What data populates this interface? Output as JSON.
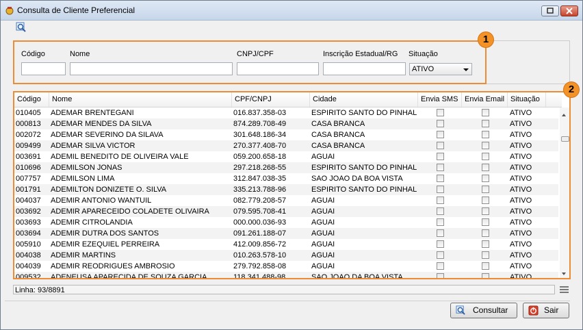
{
  "window": {
    "title": "Consulta de Cliente Preferencial"
  },
  "markers": {
    "one": "1",
    "two": "2"
  },
  "filters": {
    "codigo_label": "Código",
    "nome_label": "Nome",
    "cpf_label": "CNPJ/CPF",
    "ie_label": "Inscrição Estadual/RG",
    "situacao_label": "Situação",
    "situacao_value": "ATIVO",
    "codigo_value": "",
    "nome_value": "",
    "cpf_value": "",
    "ie_value": ""
  },
  "grid": {
    "columns": [
      "Código",
      "Nome",
      "CPF/CNPJ",
      "Cidade",
      "Envia SMS",
      "Envia Email",
      "Situação"
    ],
    "rows": [
      [
        "010405",
        "ADEMAR BRENTEGANI",
        "016.837.358-03",
        "ESPIRITO SANTO DO PINHAL",
        "ATIVO"
      ],
      [
        "000813",
        "ADEMAR MENDES DA SILVA",
        "874.289.708-49",
        "CASA BRANCA",
        "ATIVO"
      ],
      [
        "002072",
        "ADEMAR SEVERINO DA SILAVA",
        "301.648.186-34",
        "CASA BRANCA",
        "ATIVO"
      ],
      [
        "009499",
        "ADEMAR SILVA VICTOR",
        "270.377.408-70",
        "CASA BRANCA",
        "ATIVO"
      ],
      [
        "003691",
        "ADEMIL BENEDITO DE OLIVEIRA VALE",
        "059.200.658-18",
        "AGUAI",
        "ATIVO"
      ],
      [
        "010696",
        "ADEMILSON JONAS",
        "297.218.268-55",
        "ESPIRITO SANTO DO PINHAL",
        "ATIVO"
      ],
      [
        "007757",
        "ADEMILSON LIMA",
        "312.847.038-35",
        "SAO JOAO DA BOA VISTA",
        "ATIVO"
      ],
      [
        "001791",
        "ADEMILTON DONIZETE O. SILVA",
        "335.213.788-96",
        "ESPIRITO SANTO DO PINHAL",
        "ATIVO"
      ],
      [
        "004037",
        "ADEMIR ANTONIO WANTUIL",
        "082.779.208-57",
        "AGUAI",
        "ATIVO"
      ],
      [
        "003692",
        "ADEMIR APARECEIDO COLADETE OLIVAIRA",
        "079.595.708-41",
        "AGUAI",
        "ATIVO"
      ],
      [
        "003693",
        "ADEMIR CITROLANDIA",
        "000.000.036-93",
        "AGUAI",
        "ATIVO"
      ],
      [
        "003694",
        "ADEMIR DUTRA DOS SANTOS",
        "091.261.188-07",
        "AGUAI",
        "ATIVO"
      ],
      [
        "005910",
        "ADEMIR EZEQUIEL PERREIRA",
        "412.009.856-72",
        "AGUAI",
        "ATIVO"
      ],
      [
        "004038",
        "ADEMIR MARTINS",
        "010.263.578-10",
        "AGUAI",
        "ATIVO"
      ],
      [
        "004039",
        "ADEMIR REODRIGUES AMBROSIO",
        "279.792.858-08",
        "AGUAI",
        "ATIVO"
      ],
      [
        "009532",
        "ADENEUSA APARECIDA DE SOUZA GARCIA",
        "118.341.488-98",
        "SAO JOAO DA BOA VISTA",
        "ATIVO"
      ]
    ]
  },
  "status": {
    "text": "Linha: 93/8891"
  },
  "buttons": {
    "consultar": "Consultar",
    "sair": "Sair"
  },
  "colors": {
    "highlight": "#ec8c35",
    "marker": "#f39227"
  },
  "icons": {
    "app": "app-icon",
    "search": "search-icon",
    "close": "close-icon"
  }
}
